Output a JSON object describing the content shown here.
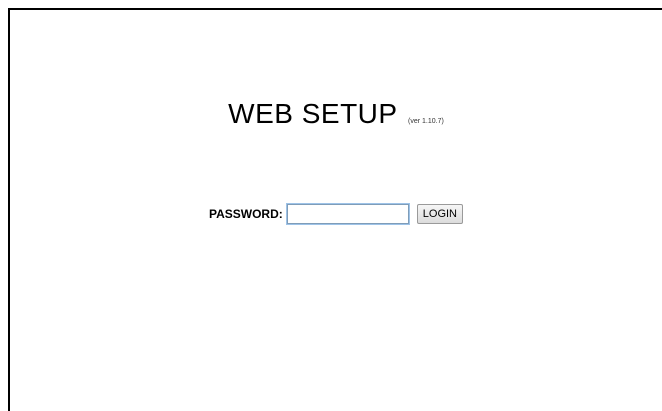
{
  "header": {
    "title": "WEB SETUP",
    "version": "(ver 1.10.7)"
  },
  "login": {
    "password_label": "PASSWORD:",
    "password_value": "",
    "password_placeholder": "",
    "button_label": "LOGIN"
  }
}
